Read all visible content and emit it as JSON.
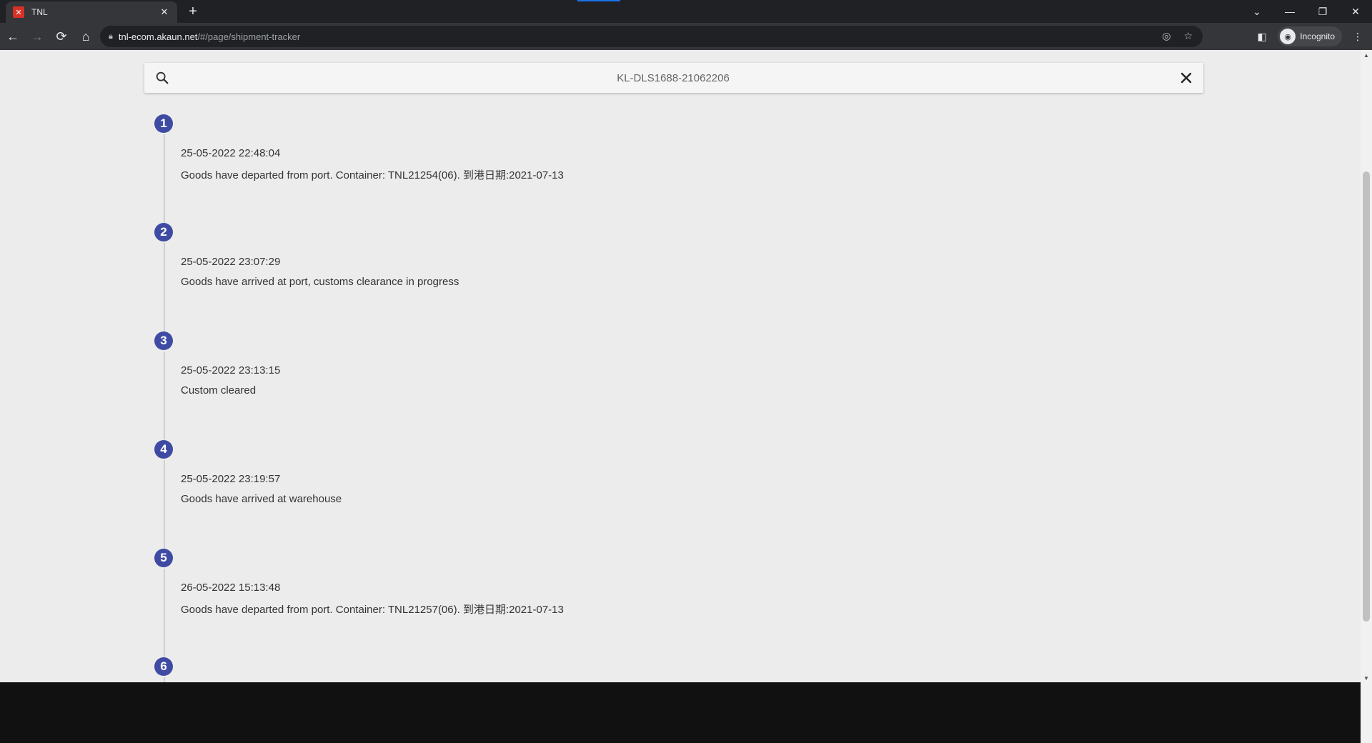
{
  "browser": {
    "tab_title": "TNL",
    "tab_favicon_text": "✕",
    "url_host": "tnl-ecom.akaun.net",
    "url_path": "/#/page/shipment-tracker",
    "profile_label": "Incognito"
  },
  "search": {
    "value": "KL-DLS1688-21062206"
  },
  "events": [
    {
      "step": "1",
      "time": "25-05-2022 22:48:04",
      "description": "Goods have departed from port. Container: TNL21254(06). 到港日期:2021-07-13"
    },
    {
      "step": "2",
      "time": "25-05-2022 23:07:29",
      "description": "Goods have arrived at port, customs clearance in progress"
    },
    {
      "step": "3",
      "time": "25-05-2022 23:13:15",
      "description": "Custom cleared"
    },
    {
      "step": "4",
      "time": "25-05-2022 23:19:57",
      "description": "Goods have arrived at warehouse"
    },
    {
      "step": "5",
      "time": "26-05-2022 15:13:48",
      "description": "Goods have departed from port. Container: TNL21257(06). 到港日期:2021-07-13"
    },
    {
      "step": "6",
      "time": "",
      "description": ""
    }
  ],
  "colors": {
    "badge": "#3f4ba3",
    "page_background": "#ececec"
  }
}
